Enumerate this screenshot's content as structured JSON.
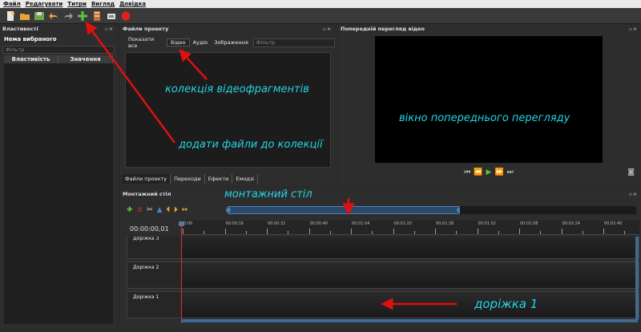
{
  "menu": [
    "Файл",
    "Редагувати",
    "Титри",
    "Вигляд",
    "Довідка"
  ],
  "toolbar_icons": [
    "new-project-icon",
    "open-project-icon",
    "save-project-icon",
    "undo-icon",
    "redo-icon",
    "add-file-icon",
    "add-track-icon",
    "export-icon",
    "record-icon"
  ],
  "properties": {
    "title": "Властивості",
    "none_selected": "Нема вибраного",
    "filter_placeholder": "Фільтр",
    "col_property": "Властивість",
    "col_value": "Значення"
  },
  "project_files": {
    "title": "Файли проекту",
    "tabs": [
      "Показати все",
      "Відео",
      "Аудіо",
      "Зображення"
    ],
    "active_tab": "Відео",
    "filter_placeholder": "Фільтр",
    "bottom_tabs": [
      "Файли проекту",
      "Переходи",
      "Ефекти",
      "Емодзі"
    ]
  },
  "preview": {
    "title": "Попередній перегляд відео"
  },
  "timeline": {
    "title": "Монтажний стіл",
    "timecode": "00:00:00,01",
    "ruler_labels": [
      "0:00",
      "00:00:16",
      "00:00:32",
      "00:00:48",
      "00:01:04",
      "00:01:20",
      "00:01:36",
      "00:01:52",
      "00:02:08",
      "00:02:24",
      "00:02:40"
    ],
    "tracks": [
      "Доріжка 3",
      "Доріжка 2",
      "Доріжка 1"
    ]
  },
  "annotations": {
    "clips": "колекція відеофрагментів",
    "add_files": "додати файли до колекції",
    "preview_window": "вікно попереднього перегляду",
    "timeline": "монтажний стіл",
    "track": "доріжка 1"
  },
  "colors": {
    "annotation": "#24d4e6",
    "arrow": "#e01010",
    "accent": "#4e82b3",
    "play": "#5fc43a"
  }
}
